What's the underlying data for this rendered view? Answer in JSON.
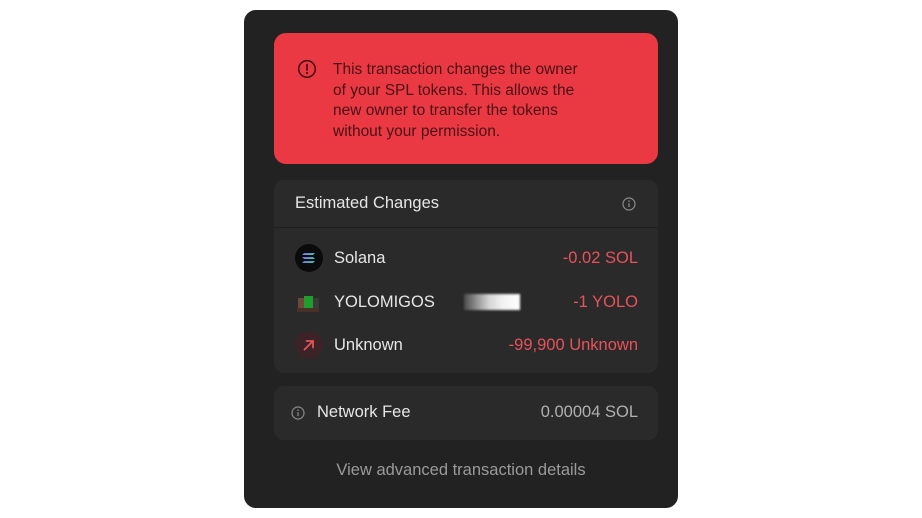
{
  "warning": {
    "lines": [
      "This transaction changes the owner",
      "of your SPL tokens. This allows the",
      "new owner to transfer the tokens",
      "without your permission."
    ],
    "icon": "alert-circle-icon"
  },
  "estimated_changes": {
    "title": "Estimated Changes",
    "info_icon": "info-icon",
    "items": [
      {
        "name": "Solana",
        "amount": "-0.02 SOL",
        "icon": "solana-icon"
      },
      {
        "name": "YOLOMIGOS",
        "amount": "-1 YOLO",
        "icon": "yolo-nft-icon"
      },
      {
        "name": "Unknown",
        "amount": "-99,900 Unknown",
        "icon": "arrow-up-right-icon"
      }
    ]
  },
  "network_fee": {
    "label": "Network Fee",
    "value": "0.00004 SOL",
    "info_icon": "info-icon"
  },
  "advanced_link": "View advanced transaction details",
  "colors": {
    "panel_bg": "#222222",
    "card_bg": "#2a2a2a",
    "warning_bg": "#ea3943",
    "negative_amount": "#e8525a",
    "text_primary": "#e6e6e6",
    "text_muted": "#9a9a9a"
  }
}
